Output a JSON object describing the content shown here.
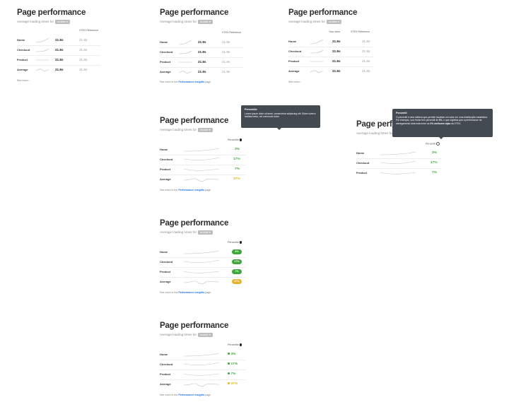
{
  "title": "Page performance",
  "subtitle": "Average loading times for",
  "badge": "mobile",
  "col_value": "Your store",
  "col_ref": "VTEX Reference",
  "percentile_label": "Percentile",
  "percentil_label": "Percentil",
  "rows": {
    "home": "Home",
    "checkout": "Checkout",
    "product": "Product",
    "average": "Average"
  },
  "time_value": "21.8s",
  "see_more": "See more",
  "footer": {
    "prefix": "See more in the",
    "link": "Performance insights",
    "suffix": "page"
  },
  "percentiles": {
    "home": "3%",
    "checkout": "17%",
    "product": "7%",
    "average": "37%"
  },
  "colors": {
    "good": "#3fa63c",
    "warn": "#e4b42b",
    "link": "#1a73e8",
    "tooltip": "#444a52"
  },
  "tooltip1": {
    "title": "Percentile",
    "body": "Lorem ipsum dolor sit amet, consectetur adipiscing elit. Etiam viverra facilisis tortor, vel commodo dolor."
  },
  "tooltip2": {
    "title": "Percentil",
    "body_a": "O percentil é uma métrica que permite localizar um valor em uma distribuição estatística. Por exemplo, sua Home tem percentil de",
    "body_b": "3%",
    "body_c": ", o que significa que a performance de carregamento dela está entre as",
    "body_d": "3% melhores lojas",
    "body_e": "da VTEX."
  }
}
